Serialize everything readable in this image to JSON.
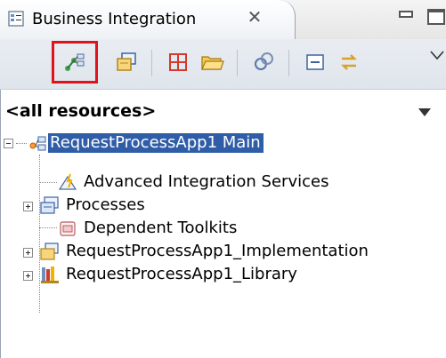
{
  "tab": {
    "title": "Business Integration",
    "close_glyph": "✕",
    "icon": "business-integration-icon"
  },
  "toolbar": {
    "buttons": [
      {
        "name": "show-dependency-icon",
        "highlighted": true
      },
      {
        "name": "new-module-icon"
      },
      {
        "name": "add-element-icon"
      },
      {
        "name": "open-folder-icon"
      },
      {
        "name": "link-editor-icon"
      },
      {
        "name": "collapse-all-icon"
      },
      {
        "name": "sync-icon"
      }
    ],
    "highlight_color": "#e0131c"
  },
  "filter": {
    "label": "<all resources>"
  },
  "tree": {
    "root": {
      "label": "RequestProcessApp1 Main",
      "selected": true,
      "icon": "process-app-icon"
    },
    "children": [
      {
        "label": "Advanced Integration Services",
        "expandable": false,
        "icon": "integration-services-icon"
      },
      {
        "label": "Processes",
        "expandable": true,
        "icon": "processes-icon"
      },
      {
        "label": "Dependent Toolkits",
        "expandable": false,
        "icon": "toolkits-icon"
      },
      {
        "label": "RequestProcessApp1_Implementation",
        "expandable": true,
        "icon": "implementation-icon"
      },
      {
        "label": "RequestProcessApp1_Library",
        "expandable": true,
        "icon": "library-icon"
      }
    ]
  },
  "colors": {
    "selection": "#2f5da8",
    "highlight_box": "#e0131c"
  }
}
